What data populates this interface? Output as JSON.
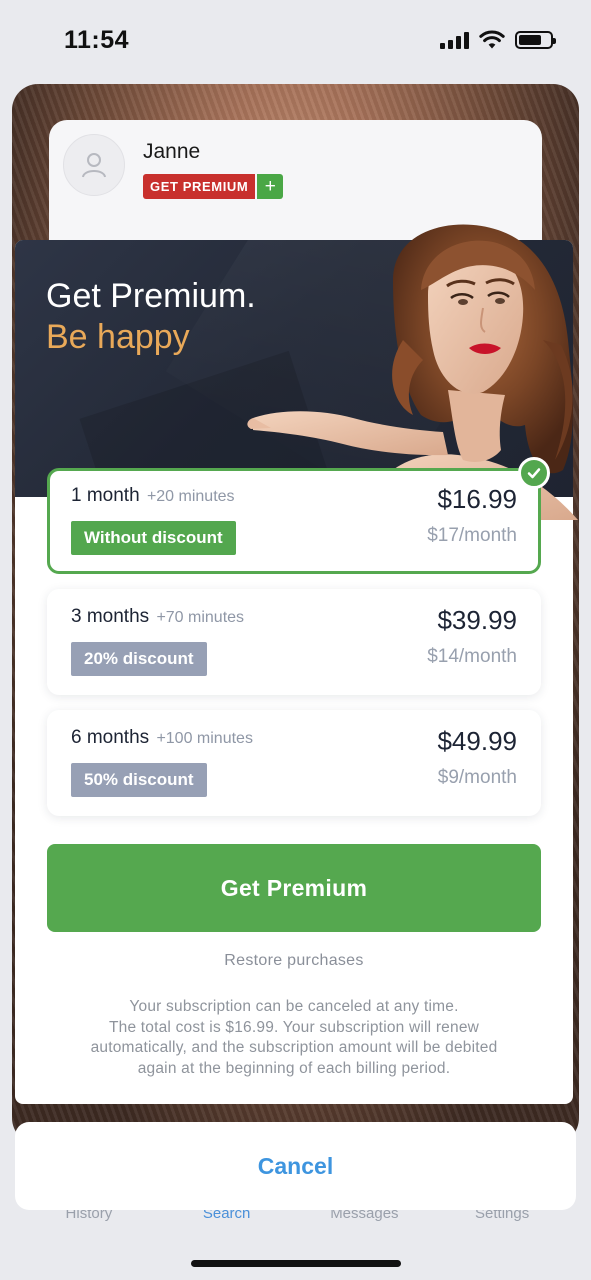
{
  "status_bar": {
    "time": "11:54",
    "icons": [
      "signal-icon",
      "wifi-icon",
      "battery-icon"
    ]
  },
  "profile": {
    "name": "Janne",
    "premium_tag": "GET PREMIUM",
    "plus": "+",
    "avatar_icon": "user-icon"
  },
  "hero": {
    "title": "Get Premium.",
    "subtitle": "Be happy"
  },
  "plans": [
    {
      "duration": "1 month",
      "extra": "+20 minutes",
      "badge": "Without discount",
      "price": "$16.99",
      "monthly": "$17/month",
      "selected": true
    },
    {
      "duration": "3 months",
      "extra": "+70 minutes",
      "badge": "20% discount",
      "price": "$39.99",
      "monthly": "$14/month",
      "selected": false
    },
    {
      "duration": "6 months",
      "extra": "+100 minutes",
      "badge": "50% discount",
      "price": "$49.99",
      "monthly": "$9/month",
      "selected": false
    }
  ],
  "cta": {
    "label": "Get Premium"
  },
  "restore": {
    "label": "Restore purchases"
  },
  "disclaimer": {
    "lines": [
      "Your subscription can be canceled at any time.",
      "The total cost is $16.99. Your subscription will renew",
      "automatically, and the subscription amount will be debited",
      "again at the beginning of each billing period."
    ]
  },
  "tabbar": {
    "items": [
      "History",
      "Search",
      "Messages",
      "Settings"
    ],
    "active": "Search"
  },
  "cancel": {
    "label": "Cancel"
  },
  "colors": {
    "accent_green": "#55a84f",
    "badge_grey": "#97a0b5",
    "hero_subtitle": "#e9a959",
    "cancel_blue": "#3e95df",
    "premium_red": "#c8302d"
  }
}
